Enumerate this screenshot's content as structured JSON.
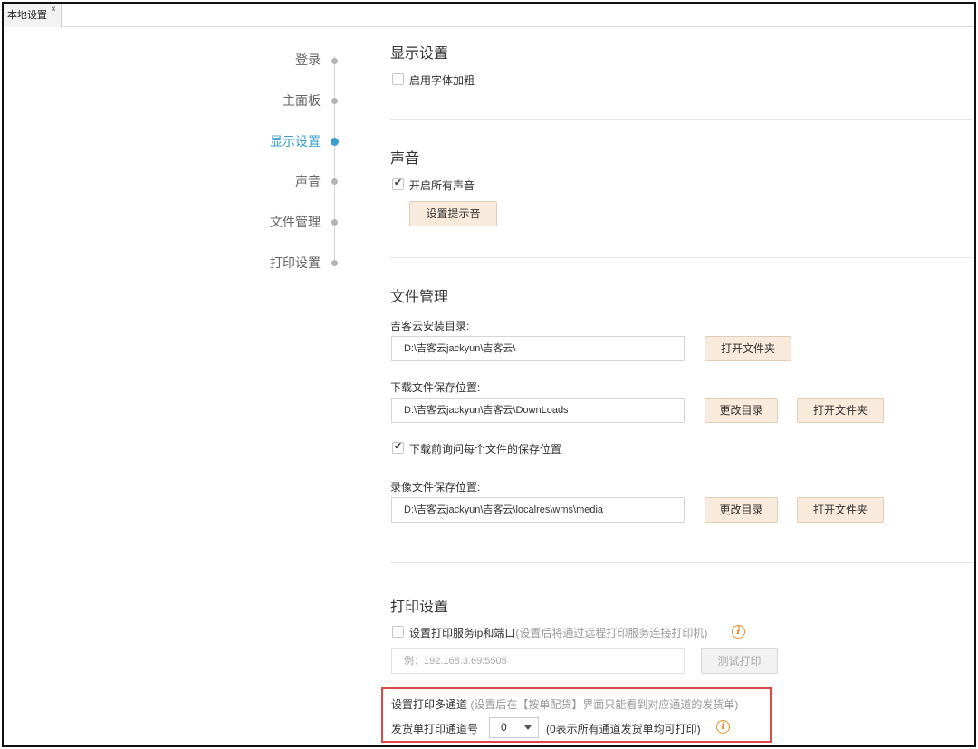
{
  "tab": {
    "label": "本地设置",
    "close_glyph": "×"
  },
  "nav": {
    "items": [
      {
        "label": "登录"
      },
      {
        "label": "主面板"
      },
      {
        "label": "显示设置"
      },
      {
        "label": "声音"
      },
      {
        "label": "文件管理"
      },
      {
        "label": "打印设置"
      }
    ],
    "active_index": 2,
    "accent_color": "#3a9dd0"
  },
  "display": {
    "title": "显示设置",
    "bold_font_label": "启用字体加粗",
    "bold_font_checked": false
  },
  "sound": {
    "title": "声音",
    "enable_all_label": "开启所有声音",
    "enable_all_checked": true,
    "set_tone_button": "设置提示音"
  },
  "files": {
    "title": "文件管理",
    "install_dir_label": "吉客云安装目录:",
    "install_dir_value": "D:\\吉客云jackyun\\吉客云\\",
    "download_dir_label": "下载文件保存位置:",
    "download_dir_value": "D:\\吉客云jackyun\\吉客云\\DownLoads",
    "ask_each_label": "下载前询问每个文件的保存位置",
    "ask_each_checked": true,
    "video_dir_label": "录像文件保存位置:",
    "video_dir_value": "D:\\吉客云jackyun\\吉客云\\localres\\wms\\media",
    "open_folder_button": "打开文件夹",
    "change_dir_button": "更改目录"
  },
  "print": {
    "title": "打印设置",
    "server_label": "设置打印服务ip和端口",
    "server_hint": "(设置后将通过远程打印服务连接打印机)",
    "server_checked": false,
    "server_placeholder": "例：192.168.3.69:5505",
    "test_print_button": "测试打印",
    "multi_channel_label": "设置打印多通道",
    "multi_channel_hint": "(设置后在【按单配货】界面只能看到对应通道的发货单)",
    "channel_no_label": "发货单打印通道号",
    "channel_no_value": "0",
    "channel_no_hint": "(0表示所有通道发货单均可打印)",
    "highlight_color": "#e04848",
    "info_color": "#f08a24"
  }
}
